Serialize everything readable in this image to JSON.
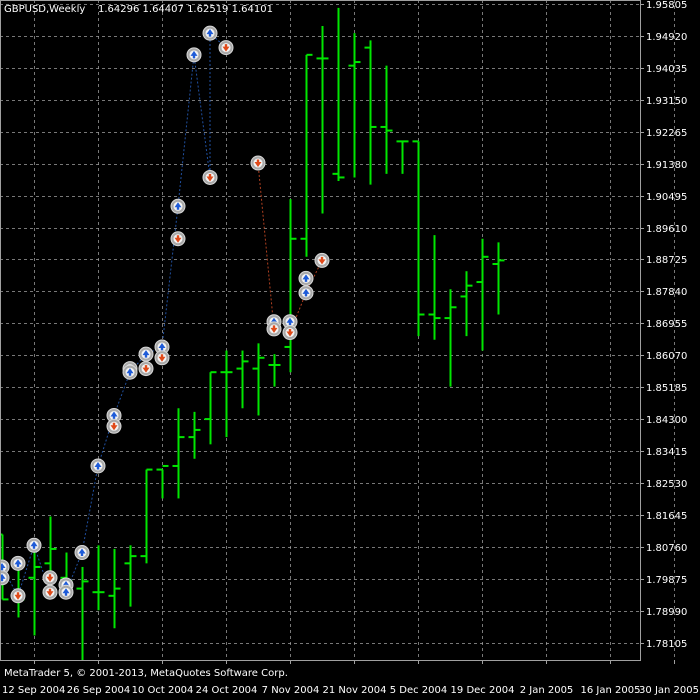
{
  "header": {
    "symbol": "GBPUSD,Weekly",
    "ohlc": "1.64296 1.64407 1.62519 1.64101"
  },
  "footer": {
    "copyright": "MetaTrader 5, © 2001-2013, MetaQuotes Software Corp."
  },
  "colors": {
    "background": "#000000",
    "bar": "#00e600",
    "grid": "#a0a0a0",
    "text": "#ffffff",
    "up_line": "#2050a0",
    "down_line": "#b04020",
    "up_arrow": "#1e5bd8",
    "down_arrow": "#e04a1a",
    "marker_ring": "#a8a8a8"
  },
  "chart_data": {
    "type": "ohlc",
    "title": "GBPUSD,Weekly",
    "xlabel": "",
    "ylabel": "",
    "ylim": [
      1.7762,
      1.9592
    ],
    "y_ticks": [
      "1.95805",
      "1.94920",
      "1.94035",
      "1.93150",
      "1.92265",
      "1.91380",
      "1.90495",
      "1.89610",
      "1.88725",
      "1.87840",
      "1.86955",
      "1.86070",
      "1.85185",
      "1.84300",
      "1.83415",
      "1.82530",
      "1.81645",
      "1.80760",
      "1.79875",
      "1.78990",
      "1.78105"
    ],
    "x_ticks": [
      "12 Sep 2004",
      "26 Sep 2004",
      "10 Oct 2004",
      "24 Oct 2004",
      "7 Nov 2004",
      "21 Nov 2004",
      "5 Dec 2004",
      "19 Dec 2004",
      "2 Jan 2005",
      "16 Jan 2005",
      "30 Jan 2005"
    ],
    "grid": true,
    "bars": [
      {
        "o": 1.811,
        "h": 1.811,
        "l": 1.793,
        "c": 1.793
      },
      {
        "o": 1.793,
        "h": 1.802,
        "l": 1.788,
        "c": 1.793
      },
      {
        "o": 1.799,
        "h": 1.809,
        "l": 1.783,
        "c": 1.802
      },
      {
        "o": 1.803,
        "h": 1.816,
        "l": 1.794,
        "c": 1.807
      },
      {
        "o": 1.799,
        "h": 1.806,
        "l": 1.796,
        "c": 1.798
      },
      {
        "o": 1.796,
        "h": 1.802,
        "l": 1.776,
        "c": 1.798
      },
      {
        "o": 1.795,
        "h": 1.808,
        "l": 1.79,
        "c": 1.795
      },
      {
        "o": 1.794,
        "h": 1.807,
        "l": 1.785,
        "c": 1.796
      },
      {
        "o": 1.803,
        "h": 1.808,
        "l": 1.791,
        "c": 1.805
      },
      {
        "o": 1.805,
        "h": 1.829,
        "l": 1.803,
        "c": 1.829
      },
      {
        "o": 1.829,
        "h": 1.829,
        "l": 1.821,
        "c": 1.83
      },
      {
        "o": 1.83,
        "h": 1.846,
        "l": 1.821,
        "c": 1.838
      },
      {
        "o": 1.838,
        "h": 1.845,
        "l": 1.832,
        "c": 1.84
      },
      {
        "o": 1.843,
        "h": 1.856,
        "l": 1.836,
        "c": 1.856
      },
      {
        "o": 1.856,
        "h": 1.862,
        "l": 1.838,
        "c": 1.856
      },
      {
        "o": 1.857,
        "h": 1.862,
        "l": 1.846,
        "c": 1.859
      },
      {
        "o": 1.857,
        "h": 1.864,
        "l": 1.844,
        "c": 1.86
      },
      {
        "o": 1.858,
        "h": 1.861,
        "l": 1.852,
        "c": 1.858
      },
      {
        "o": 1.863,
        "h": 1.904,
        "l": 1.856,
        "c": 1.893
      },
      {
        "o": 1.893,
        "h": 1.944,
        "l": 1.888,
        "c": 1.944
      },
      {
        "o": 1.943,
        "h": 1.952,
        "l": 1.9,
        "c": 1.943
      },
      {
        "o": 1.911,
        "h": 1.957,
        "l": 1.909,
        "c": 1.91
      },
      {
        "o": 1.941,
        "h": 1.95,
        "l": 1.91,
        "c": 1.942
      },
      {
        "o": 1.946,
        "h": 1.948,
        "l": 1.908,
        "c": 1.924
      },
      {
        "o": 1.924,
        "h": 1.941,
        "l": 1.911,
        "c": 1.923
      },
      {
        "o": 1.92,
        "h": 1.92,
        "l": 1.911,
        "c": 1.92
      },
      {
        "o": 1.92,
        "h": 1.92,
        "l": 1.866,
        "c": 1.872
      },
      {
        "o": 1.872,
        "h": 1.894,
        "l": 1.865,
        "c": 1.871
      },
      {
        "o": 1.871,
        "h": 1.879,
        "l": 1.852,
        "c": 1.874
      },
      {
        "o": 1.877,
        "h": 1.884,
        "l": 1.866,
        "c": 1.88
      },
      {
        "o": 1.881,
        "h": 1.893,
        "l": 1.862,
        "c": 1.888
      },
      {
        "o": 1.886,
        "h": 1.892,
        "l": 1.872,
        "c": 1.887
      }
    ],
    "markers": [
      {
        "bar": 0,
        "v": 1.802,
        "d": "up"
      },
      {
        "bar": 0,
        "v": 1.799,
        "d": "up"
      },
      {
        "bar": 2,
        "v": 1.794,
        "d": "down"
      },
      {
        "bar": 2,
        "v": 1.803,
        "d": "up"
      },
      {
        "bar": 4,
        "v": 1.808,
        "d": "up"
      },
      {
        "bar": 6,
        "v": 1.799,
        "d": "down"
      },
      {
        "bar": 6,
        "v": 1.795,
        "d": "down"
      },
      {
        "bar": 8,
        "v": 1.797,
        "d": "up"
      },
      {
        "bar": 8,
        "v": 1.795,
        "d": "up"
      },
      {
        "bar": 10,
        "v": 1.806,
        "d": "up"
      },
      {
        "bar": 12,
        "v": 1.83,
        "d": "up"
      },
      {
        "bar": 14,
        "v": 1.844,
        "d": "up"
      },
      {
        "bar": 14,
        "v": 1.841,
        "d": "down"
      },
      {
        "bar": 16,
        "v": 1.857,
        "d": "down"
      },
      {
        "bar": 16,
        "v": 1.856,
        "d": "up"
      },
      {
        "bar": 18,
        "v": 1.861,
        "d": "up"
      },
      {
        "bar": 18,
        "v": 1.857,
        "d": "down"
      },
      {
        "bar": 20,
        "v": 1.863,
        "d": "up"
      },
      {
        "bar": 20,
        "v": 1.86,
        "d": "down"
      },
      {
        "bar": 22,
        "v": 1.902,
        "d": "up"
      },
      {
        "bar": 22,
        "v": 1.893,
        "d": "down"
      },
      {
        "bar": 24,
        "v": 1.944,
        "d": "up"
      },
      {
        "bar": 26,
        "v": 1.91,
        "d": "down"
      },
      {
        "bar": 26,
        "v": 1.95,
        "d": "up"
      },
      {
        "bar": 28,
        "v": 1.946,
        "d": "down"
      },
      {
        "bar": 32,
        "v": 1.914,
        "d": "down"
      },
      {
        "bar": 34,
        "v": 1.87,
        "d": "up"
      },
      {
        "bar": 34,
        "v": 1.868,
        "d": "down"
      },
      {
        "bar": 36,
        "v": 1.87,
        "d": "up"
      },
      {
        "bar": 36,
        "v": 1.867,
        "d": "down"
      },
      {
        "bar": 38,
        "v": 1.882,
        "d": "up"
      },
      {
        "bar": 38,
        "v": 1.878,
        "d": "up"
      },
      {
        "bar": 40,
        "v": 1.887,
        "d": "down"
      }
    ],
    "lines": [
      {
        "d": "up",
        "pts": [
          [
            0,
            1.802
          ],
          [
            2,
            1.794
          ],
          [
            4,
            1.808
          ],
          [
            6,
            1.795
          ],
          [
            8,
            1.795
          ],
          [
            10,
            1.806
          ],
          [
            12,
            1.83
          ],
          [
            14,
            1.844
          ],
          [
            16,
            1.856
          ],
          [
            18,
            1.861
          ],
          [
            20,
            1.863
          ],
          [
            22,
            1.902
          ],
          [
            24,
            1.944
          ],
          [
            26,
            1.91
          ],
          [
            26,
            1.95
          ],
          [
            28,
            1.946
          ]
        ]
      },
      {
        "d": "down",
        "pts": [
          [
            32,
            1.914
          ],
          [
            34,
            1.868
          ],
          [
            36,
            1.867
          ],
          [
            38,
            1.878
          ],
          [
            40,
            1.887
          ]
        ]
      }
    ]
  }
}
